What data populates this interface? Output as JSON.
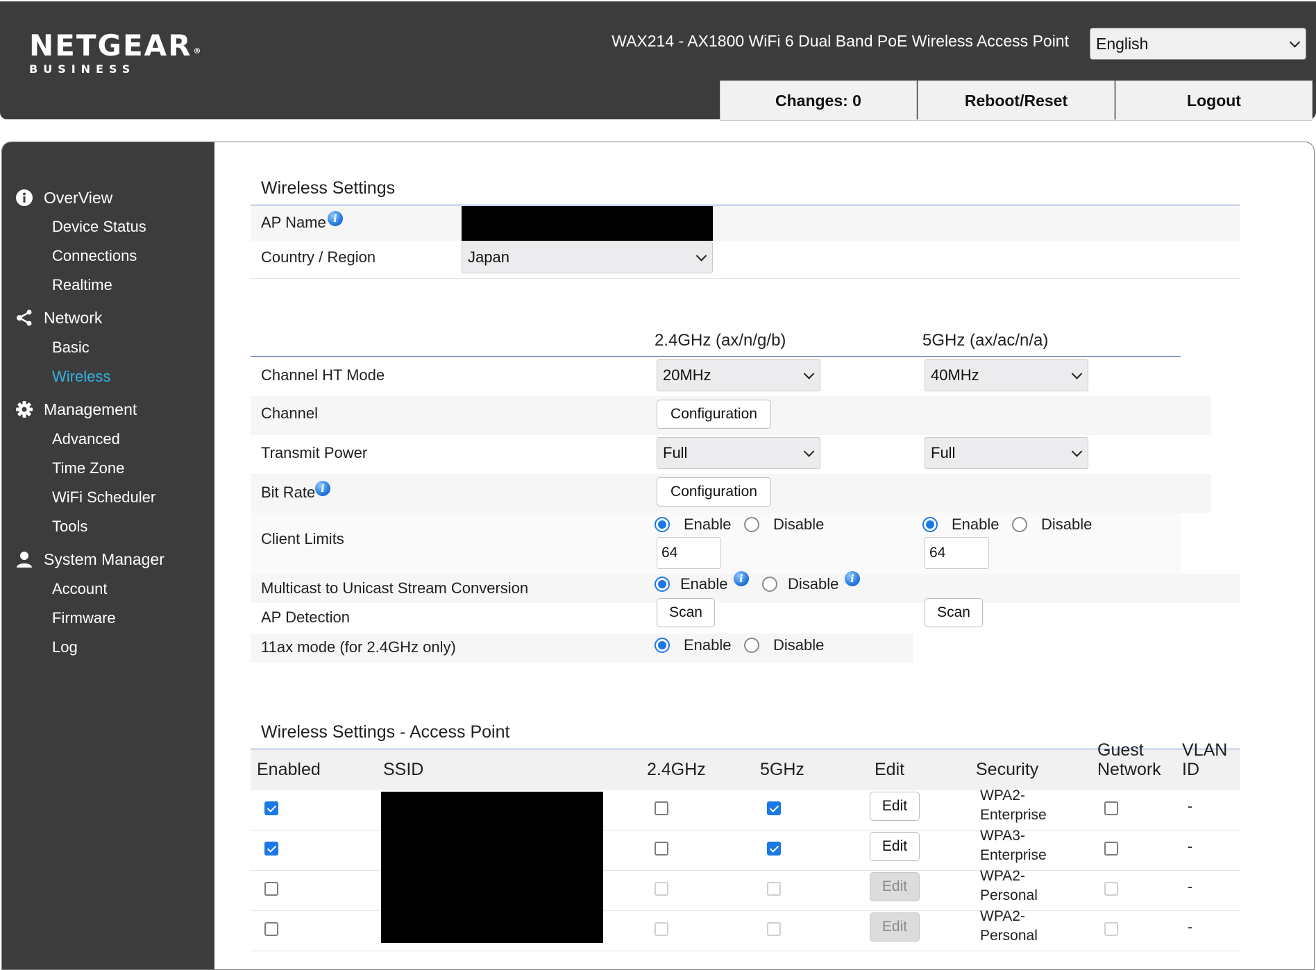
{
  "header": {
    "logo_brand": "NETGEAR",
    "logo_mark": "®",
    "logo_sub": "BUSINESS",
    "device_title": "WAX214 - AX1800 WiFi 6 Dual Band PoE Wireless Access Point",
    "language": "English",
    "buttons": {
      "changes": "Changes: 0",
      "reboot": "Reboot/Reset",
      "logout": "Logout"
    }
  },
  "sidebar": {
    "overview": {
      "label": "OverView",
      "icon": "info-icon",
      "items": [
        "Device Status",
        "Connections",
        "Realtime"
      ]
    },
    "network": {
      "label": "Network",
      "icon": "share-icon",
      "items": [
        "Basic",
        "Wireless"
      ]
    },
    "management": {
      "label": "Management",
      "icon": "gear-icon",
      "items": [
        "Advanced",
        "Time Zone",
        "WiFi Scheduler",
        "Tools"
      ]
    },
    "system": {
      "label": "System Manager",
      "icon": "user-icon",
      "items": [
        "Account",
        "Firmware",
        "Log"
      ]
    },
    "active_item": "Wireless",
    "active_color": "#33b3e6"
  },
  "wireless_settings": {
    "title": "Wireless Settings",
    "ap_name_label": "AP Name",
    "country_label": "Country / Region",
    "country_value": "Japan"
  },
  "radio_settings": {
    "band_24": "2.4GHz (ax/n/g/b)",
    "band_5": "5GHz (ax/ac/n/a)",
    "channel_ht_label": "Channel HT Mode",
    "channel_ht_24": "20MHz",
    "channel_ht_5": "40MHz",
    "channel_label": "Channel",
    "configuration": "Configuration",
    "tx_power_label": "Transmit Power",
    "tx_power_24": "Full",
    "tx_power_5": "Full",
    "bit_rate_label": "Bit Rate",
    "client_limits_label": "Client Limits",
    "enable": "Enable",
    "disable": "Disable",
    "client_limit_24": "64",
    "client_limit_5": "64",
    "multicast_label": "Multicast to Unicast Stream Conversion",
    "ap_detection_label": "AP Detection",
    "scan": "Scan",
    "ax_mode_label": "11ax mode (for 2.4GHz only)"
  },
  "access_point": {
    "title": "Wireless Settings - Access Point",
    "columns": {
      "enabled": "Enabled",
      "ssid": "SSID",
      "g24": "2.4GHz",
      "g5": "5GHz",
      "edit": "Edit",
      "security": "Security",
      "guest_1": "Guest",
      "guest_2": "Network",
      "vlan_1": "VLAN",
      "vlan_2": "ID"
    },
    "rows": [
      {
        "edit": "Edit",
        "security_1": "WPA2-",
        "security_2": "Enterprise",
        "vlan": "-"
      },
      {
        "edit": "Edit",
        "security_1": "WPA3-",
        "security_2": "Enterprise",
        "vlan": "-"
      },
      {
        "edit": "Edit",
        "security_1": "WPA2-",
        "security_2": "Personal",
        "vlan": "-"
      },
      {
        "edit": "Edit",
        "security_1": "WPA2-",
        "security_2": "Personal",
        "vlan": "-"
      }
    ],
    "accent_color": "#1b78e6"
  }
}
